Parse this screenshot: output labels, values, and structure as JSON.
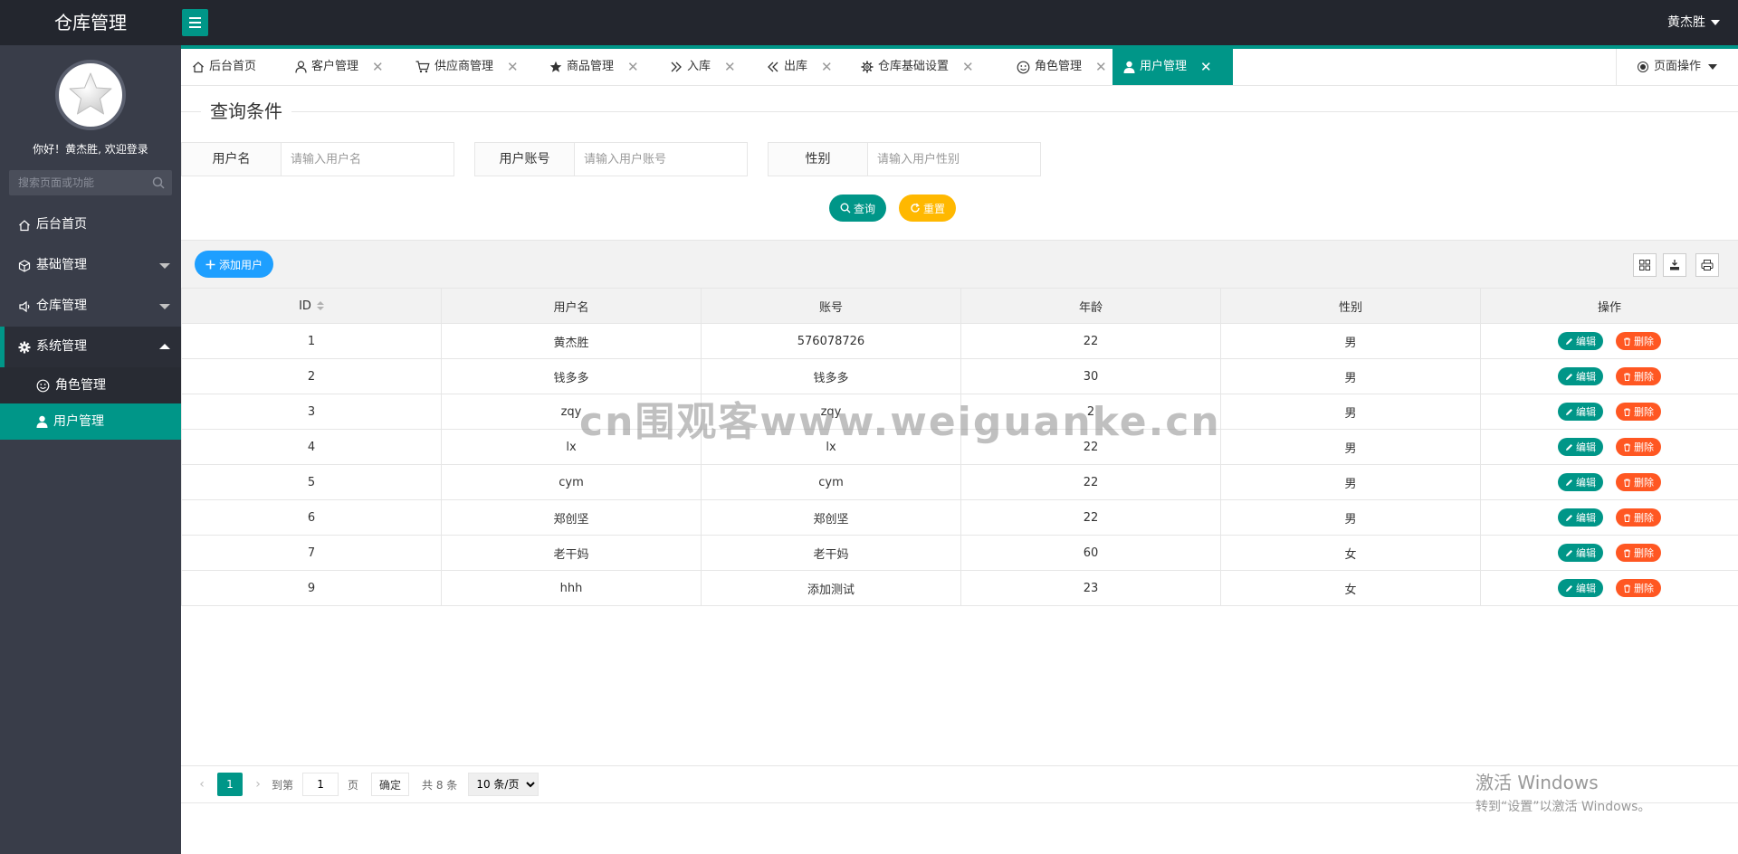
{
  "app": {
    "title": "仓库管理",
    "user": "黄杰胜"
  },
  "sidebar": {
    "welcome": "你好！黄杰胜, 欢迎登录",
    "search_placeholder": "搜索页面或功能",
    "items": [
      {
        "label": "后台首页",
        "icon": "home-icon"
      },
      {
        "label": "基础管理",
        "icon": "cube-icon"
      },
      {
        "label": "仓库管理",
        "icon": "speaker-icon"
      },
      {
        "label": "系统管理",
        "icon": "gear-icon"
      }
    ],
    "sub_items": [
      {
        "label": "角色管理",
        "icon": "smile-icon"
      },
      {
        "label": "用户管理",
        "icon": "user-icon"
      }
    ]
  },
  "tabs": [
    {
      "label": "后台首页"
    },
    {
      "label": "客户管理"
    },
    {
      "label": "供应商管理"
    },
    {
      "label": "商品管理"
    },
    {
      "label": "入库"
    },
    {
      "label": "出库"
    },
    {
      "label": "仓库基础设置"
    },
    {
      "label": "角色管理"
    },
    {
      "label": "用户管理"
    }
  ],
  "page_op": "页面操作",
  "query": {
    "legend": "查询条件",
    "fields": [
      {
        "label": "用户名",
        "placeholder": "请输入用户名"
      },
      {
        "label": "用户账号",
        "placeholder": "请输入用户账号"
      },
      {
        "label": "性别",
        "placeholder": "请输入用户性别"
      }
    ],
    "search_label": "查询",
    "reset_label": "重置"
  },
  "toolbar": {
    "add_label": "添加用户"
  },
  "table": {
    "columns": [
      "ID",
      "用户名",
      "账号",
      "年龄",
      "性别",
      "操作"
    ],
    "rows": [
      [
        "1",
        "黄杰胜",
        "576078726",
        "22",
        "男"
      ],
      [
        "2",
        "钱多多",
        "钱多多",
        "30",
        "男"
      ],
      [
        "3",
        "zqy",
        "zqy",
        "2",
        "男"
      ],
      [
        "4",
        "lx",
        "lx",
        "22",
        "男"
      ],
      [
        "5",
        "cym",
        "cym",
        "22",
        "男"
      ],
      [
        "6",
        "郑创坚",
        "郑创坚",
        "22",
        "男"
      ],
      [
        "7",
        "老干妈",
        "老干妈",
        "60",
        "女"
      ],
      [
        "9",
        "hhh",
        "添加测试",
        "23",
        "女"
      ]
    ],
    "edit_label": "编辑",
    "delete_label": "删除"
  },
  "pager": {
    "current": "1",
    "goto_label": "到第",
    "goto_value": "1",
    "page_unit": "页",
    "confirm_label": "确定",
    "total": "共 8 条",
    "page_size": "10 条/页"
  },
  "watermark": "cn围观客www.weiguanke.cn",
  "windows": {
    "line1": "激活 Windows",
    "line2": "转到“设置”以激活 Windows。"
  },
  "colors": {
    "primary": "#009688",
    "warn": "#ffb800",
    "info": "#1e9fff",
    "danger": "#ff5722",
    "header": "#23262e",
    "sidebar": "#393d49"
  }
}
